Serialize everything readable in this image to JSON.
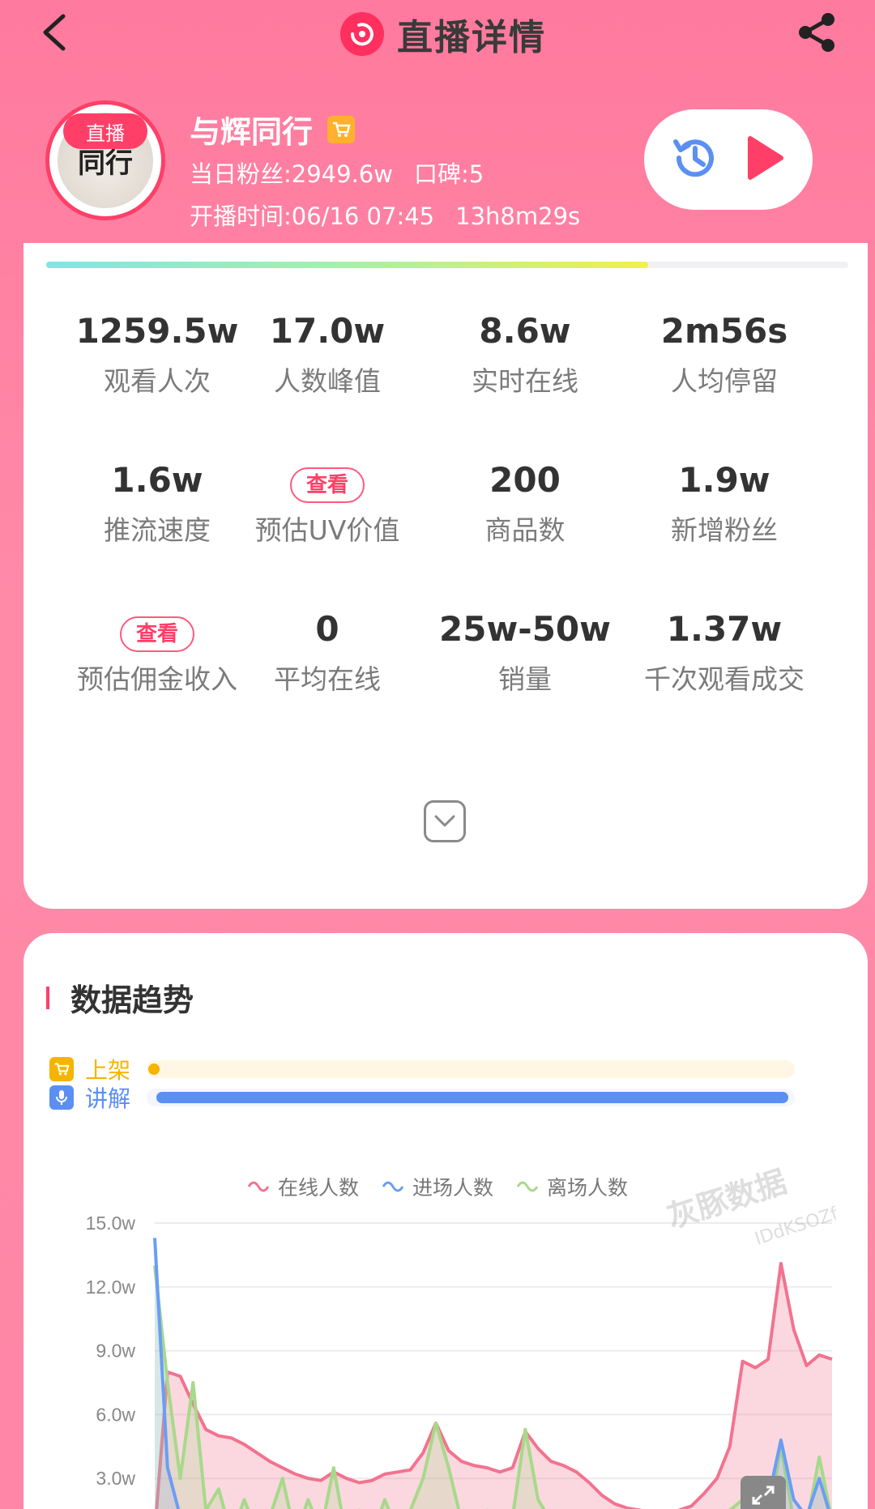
{
  "header": {
    "title": "直播详情",
    "back_icon": "chevron-left-icon",
    "share_icon": "share-icon"
  },
  "profile": {
    "live_tag": "直播",
    "avatar_text": "同行",
    "name": "与辉同行",
    "fans_text": "当日粉丝:2949.6w",
    "reputation_text": "口碑:5",
    "start_time_text": "开播时间:06/16 07:45",
    "duration_text": "13h8m29s",
    "replay_icon": "history-icon",
    "play_icon": "play-icon"
  },
  "progress": {
    "fraction": 0.75
  },
  "stats": [
    {
      "value": "1259.5w",
      "label": "观看人次"
    },
    {
      "value": "17.0w",
      "label": "人数峰值"
    },
    {
      "value": "8.6w",
      "label": "实时在线"
    },
    {
      "value": "2m56s",
      "label": "人均停留"
    },
    {
      "value": "1.6w",
      "label": "推流速度"
    },
    {
      "value": "查看",
      "label": "预估UV价值"
    },
    {
      "value": "200",
      "label": "商品数"
    },
    {
      "value": "1.9w",
      "label": "新增粉丝"
    },
    {
      "value": "查看",
      "label": "预估佣金收入"
    },
    {
      "value": "0",
      "label": "平均在线"
    },
    {
      "value": "25w-50w",
      "label": "销量"
    },
    {
      "value": "1.37w",
      "label": "千次观看成交"
    }
  ],
  "trend": {
    "title": "数据趋势",
    "tracks": [
      {
        "label": "上架",
        "color": "#f5b400",
        "bar_color": "#fff7e3"
      },
      {
        "label": "讲解",
        "color": "#5b8ff2",
        "bar_color": "#5b8ff2"
      }
    ],
    "watermark": "灰豚数据",
    "watermark_id": "IDdKSOZf"
  },
  "chart_data": {
    "type": "area",
    "series": [
      {
        "name": "在线人数",
        "color": "#f2738f",
        "values": [
          0.5,
          8.0,
          7.8,
          6.5,
          5.3,
          5.0,
          4.9,
          4.6,
          4.2,
          3.8,
          3.5,
          3.2,
          3.0,
          2.9,
          3.3,
          3.0,
          2.8,
          2.9,
          3.2,
          3.3,
          3.4,
          4.2,
          5.6,
          4.3,
          3.8,
          3.6,
          3.5,
          3.3,
          3.5,
          5.2,
          4.4,
          3.8,
          3.6,
          3.3,
          2.8,
          2.2,
          1.8,
          1.6,
          1.5,
          1.4,
          1.3,
          1.5,
          1.7,
          2.3,
          3.0,
          4.5,
          8.5,
          8.2,
          8.6,
          13.1,
          10.0,
          8.3,
          8.8,
          8.6
        ]
      },
      {
        "name": "进场人数",
        "color": "#6a9df5",
        "values": [
          14.3,
          3.5,
          1.2,
          0.5,
          0.3,
          0.2,
          0.2,
          0.1,
          0.2,
          0.1,
          0.1,
          0.1,
          0.1,
          0.1,
          0.2,
          0.1,
          0.1,
          0.1,
          0.1,
          0.1,
          0.2,
          0.5,
          0.8,
          0.5,
          0.3,
          0.3,
          0.3,
          0.2,
          0.4,
          1.0,
          0.5,
          0.4,
          0.3,
          0.2,
          0.2,
          0.1,
          0.1,
          0.1,
          0.1,
          0.1,
          0.1,
          0.1,
          0.2,
          0.3,
          0.5,
          0.8,
          1.0,
          1.5,
          2.0,
          4.8,
          2.0,
          1.2,
          3.0,
          1.0
        ]
      },
      {
        "name": "离场人数",
        "color": "#a7d98a",
        "values": [
          13.0,
          7.5,
          3.0,
          7.5,
          1.5,
          2.5,
          0.3,
          2.0,
          0.5,
          1.2,
          3.0,
          0.3,
          2.0,
          0.5,
          3.5,
          0.2,
          1.5,
          0.3,
          2.0,
          0.5,
          1.5,
          3.0,
          5.6,
          3.5,
          1.0,
          0.8,
          1.5,
          0.5,
          1.2,
          5.3,
          2.0,
          1.0,
          0.8,
          0.5,
          0.3,
          0.5,
          0.2,
          0.4,
          0.3,
          0.2,
          0.1,
          0.3,
          0.5,
          0.8,
          1.0,
          1.5,
          2.0,
          3.0,
          1.0,
          4.5,
          1.0,
          0.8,
          4.0,
          1.0
        ]
      }
    ],
    "yticks": [
      "15.0w",
      "12.0w",
      "9.0w",
      "6.0w",
      "3.0w"
    ],
    "ylim": [
      0,
      15
    ],
    "grid": true,
    "legend_position": "top-center"
  }
}
